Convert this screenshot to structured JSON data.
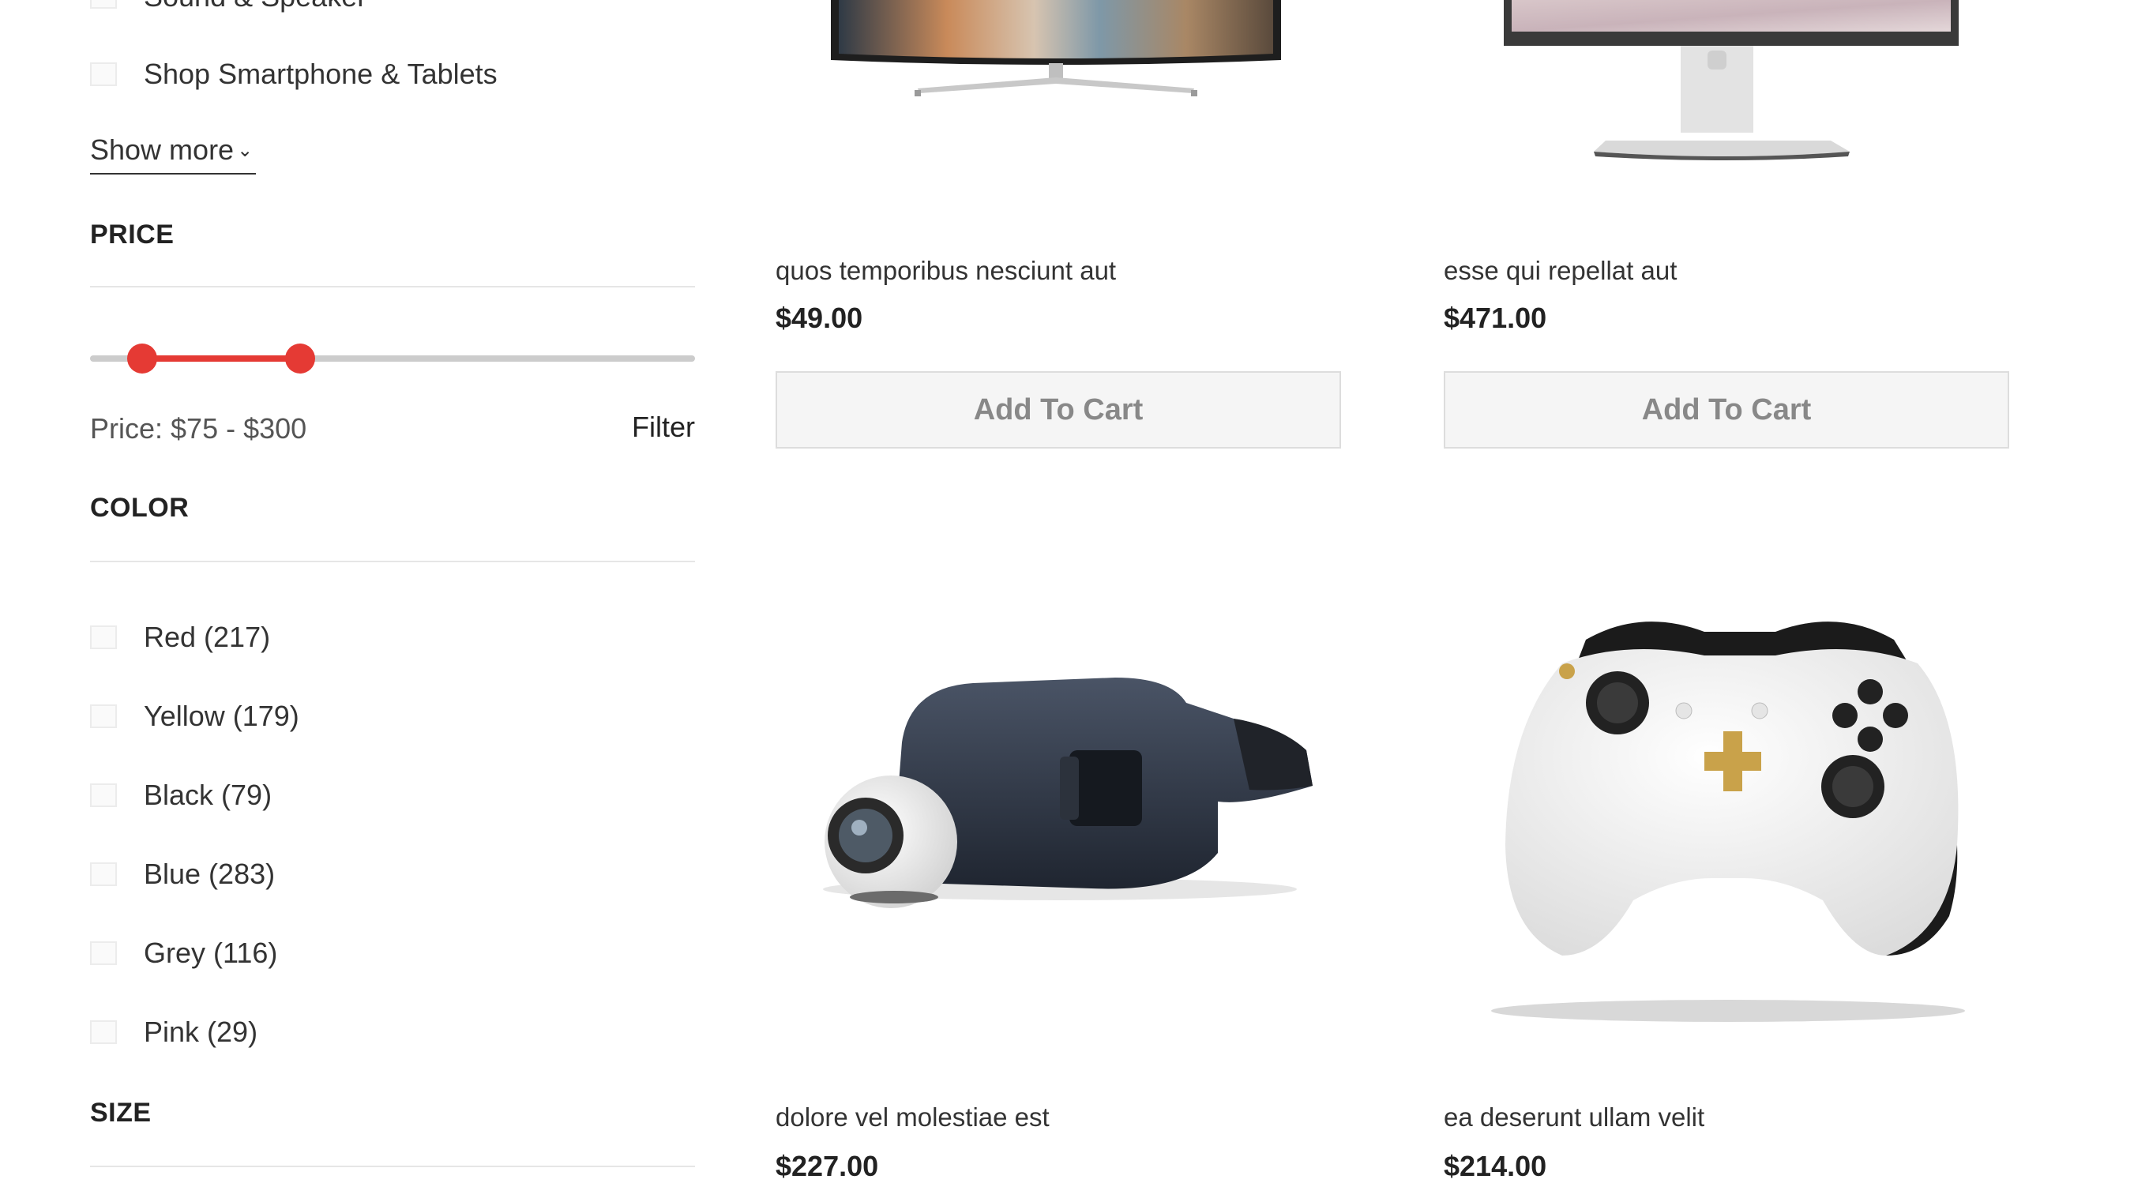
{
  "categories": {
    "items": [
      {
        "label": "Sound & Speaker"
      },
      {
        "label": "Shop Smartphone & Tablets"
      }
    ],
    "show_more": "Show more",
    "chevron_icon": "chevron-down-icon"
  },
  "price": {
    "title": "PRICE",
    "label": "Price: $75 - $300",
    "filter": "Filter",
    "min": 75,
    "max": 300,
    "accent": "#e53a34"
  },
  "color": {
    "title": "COLOR",
    "items": [
      {
        "label": "Red (217)"
      },
      {
        "label": "Yellow (179)"
      },
      {
        "label": "Black (79)"
      },
      {
        "label": "Blue (283)"
      },
      {
        "label": "Grey (116)"
      },
      {
        "label": "Pink (29)"
      }
    ]
  },
  "size": {
    "title": "SIZE"
  },
  "products": [
    {
      "title": "quos temporibus nesciunt aut",
      "price": "$49.00",
      "button": "Add To Cart",
      "image": "curved-tv-image"
    },
    {
      "title": "esse qui repellat aut",
      "price": "$471.00",
      "button": "Add To Cart",
      "image": "monitor-image"
    },
    {
      "title": "dolore vel molestiae est",
      "price": "$227.00",
      "image": "vr-headset-camera-image"
    },
    {
      "title": "ea deserunt ullam velit",
      "price": "$214.00",
      "image": "game-controller-image"
    }
  ]
}
